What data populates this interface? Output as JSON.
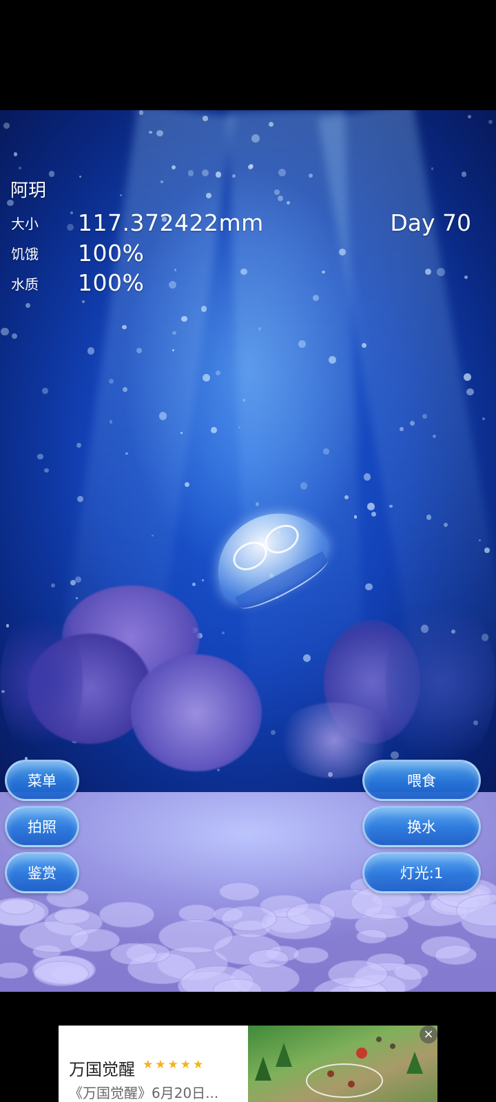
{
  "hud": {
    "name": "阿玥",
    "day": "Day 70",
    "stats": [
      {
        "label": "大小",
        "value": "117.372422mm"
      },
      {
        "label": "饥饿",
        "value": "100%"
      },
      {
        "label": "水质",
        "value": "100%"
      }
    ]
  },
  "buttons": {
    "menu": "菜单",
    "photo": "拍照",
    "appreciate": "鉴赏",
    "feed": "喂食",
    "change_water": "换水",
    "light": "灯光:1"
  },
  "ad": {
    "title": "万国觉醒",
    "stars": "★★★★★",
    "description": "《万国觉醒》6月20日...",
    "close_symbol": "×"
  },
  "icons": {
    "close": "close-icon",
    "rating": "star-icon"
  },
  "colors": {
    "water_deep": "#0a2a86",
    "water_light": "#1f5ed8",
    "button": "#2f7fdc",
    "star": "#f5b21b"
  }
}
